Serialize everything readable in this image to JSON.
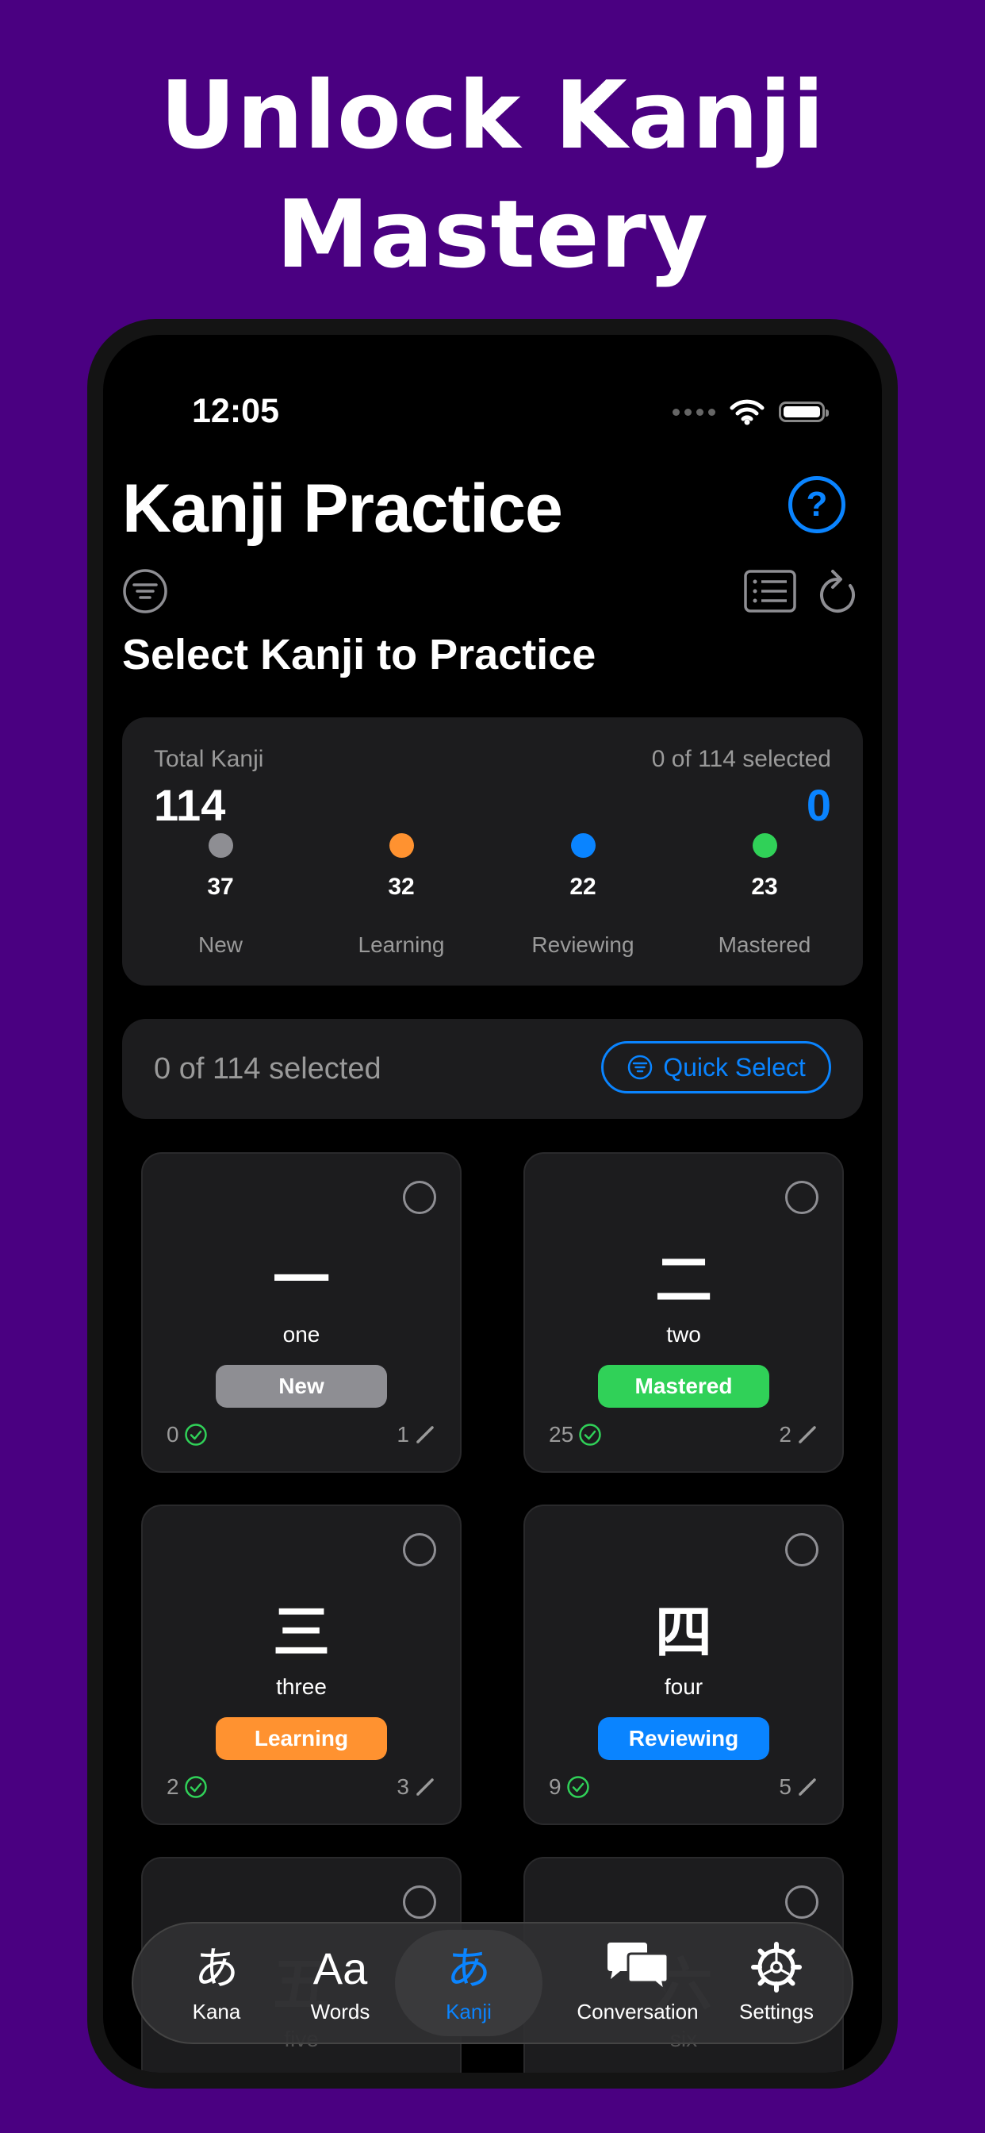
{
  "headline": {
    "line1": "Unlock Kanji",
    "line2": "Mastery"
  },
  "status": {
    "time": "12:05"
  },
  "header": {
    "title": "Kanji Practice",
    "help_icon": "?",
    "subtitle": "Select Kanji to Practice"
  },
  "summary": {
    "label": "Total Kanji",
    "total": "114",
    "selected_text": "0 of 114 selected",
    "selected_count": "0",
    "stats": [
      {
        "count": "37",
        "label": "New",
        "color": "#8e8e93"
      },
      {
        "count": "32",
        "label": "Learning",
        "color": "#ff9230"
      },
      {
        "count": "22",
        "label": "Reviewing",
        "color": "#0a84ff"
      },
      {
        "count": "23",
        "label": "Mastered",
        "color": "#30d158"
      }
    ]
  },
  "selection_bar": {
    "text": "0 of 114 selected",
    "quick_select_label": "Quick Select"
  },
  "cards": [
    {
      "kanji": "一",
      "meaning": "one",
      "status": "New",
      "status_color": "#8e8e93",
      "correct": "0",
      "attempts": "1"
    },
    {
      "kanji": "二",
      "meaning": "two",
      "status": "Mastered",
      "status_color": "#30d158",
      "correct": "25",
      "attempts": "2"
    },
    {
      "kanji": "三",
      "meaning": "three",
      "status": "Learning",
      "status_color": "#ff9230",
      "correct": "2",
      "attempts": "3"
    },
    {
      "kanji": "四",
      "meaning": "four",
      "status": "Reviewing",
      "status_color": "#0a84ff",
      "correct": "9",
      "attempts": "5"
    },
    {
      "kanji": "五",
      "meaning": "five"
    },
    {
      "kanji": "六",
      "meaning": "six"
    }
  ],
  "tabs": [
    {
      "glyph": "あ",
      "label": "Kana"
    },
    {
      "glyph": "Aa",
      "label": "Words"
    },
    {
      "glyph": "あ",
      "label": "Kanji",
      "active": true
    },
    {
      "glyph": "",
      "label": "Conversation"
    },
    {
      "glyph": "",
      "label": "Settings"
    }
  ]
}
